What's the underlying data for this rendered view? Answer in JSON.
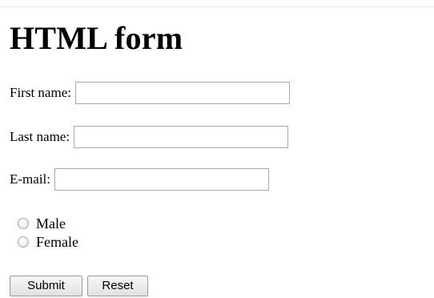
{
  "form": {
    "title": "HTML form",
    "first_name": {
      "label": "First name:",
      "value": ""
    },
    "last_name": {
      "label": "Last name:",
      "value": ""
    },
    "email": {
      "label": "E-mail:",
      "value": ""
    },
    "gender": {
      "options": [
        "Male",
        "Female"
      ],
      "selected": ""
    },
    "submit_label": "Submit",
    "reset_label": "Reset"
  }
}
